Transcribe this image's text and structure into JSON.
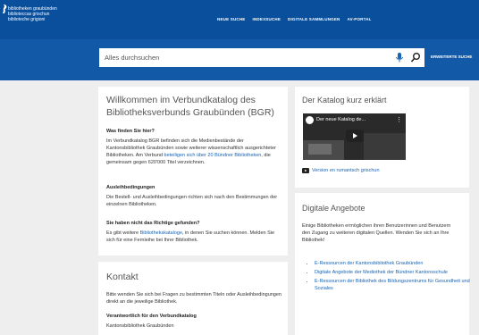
{
  "header": {
    "logo_lines": [
      "bibliotheken graubünden",
      "biblioteccas grischun",
      "biblioteche grigioni"
    ],
    "nav": [
      "NEUE SUCHE",
      "INDEXSUCHE",
      "DIGITALE SAMMLUNGEN",
      "AV-PORTAL"
    ]
  },
  "search": {
    "placeholder": "Alles durchsuchen",
    "advanced_label": "ERWEITERTE SUCHE",
    "mic_icon": "microphone-icon",
    "search_icon": "magnifier-icon"
  },
  "welcome": {
    "title": "Willkommen im Verbundkatalog des Bibliotheksverbunds Graubünden (BGR)",
    "s1_heading": "Was finden Sie hier?",
    "s1_text_a": "Im Verbundkatalog BGR befinden sich die Medienbestände der Kantonsbibliothek Graubünden sowie weiterer wissenschaftlich ausgerichteter Bibliotheken. Am Verbund ",
    "s1_link": "beteiligen sich über 20 Bündner Bibliotheken",
    "s1_text_b": ", die gemeinsam gegen 620'000 Titel verzeichnen.",
    "s2_heading": "Ausleihbedingungen",
    "s2_text": "Die Bestell- und Ausleihbedingungen richten sich nach den Bestimmungen der einzelnen Bibliotheken.",
    "s3_heading": "Sie haben nicht das Richtige gefunden?",
    "s3_text_a": "Es gibt weitere ",
    "s3_link": "Bibliothekskataloge",
    "s3_text_b": ", in denen Sie suchen können. Melden Sie sich für eine Fernleihe bei Ihrer Bibliothek."
  },
  "kontakt": {
    "title": "Kontakt",
    "text": "Bitte wenden Sie sich bei Fragen zu bestimmten Titeln oder Ausleihbedingungen direkt an die jeweilige Bibliothek.",
    "heading": "Verantwortlich für den Verbundkatalog",
    "cutoff": "Kantonsbibliothek Graubünden"
  },
  "katalog": {
    "title": "Der Katalog kurz erklärt",
    "video_title": "Der neue Katalog de...",
    "link": "Version en rumantsch grischun"
  },
  "digital": {
    "title": "Digitale Angebote",
    "text": "Einige Bibliotheken ermöglichen ihren Benutzerinnen und Benutzern den Zugang zu weiteren digitalen Quellen. Wenden Sie sich an Ihre Bibliothek!",
    "items": [
      "E-Ressourcen der Kantonsbibliothek Graubünden",
      "Digitale Angebote der Mediothek der Bündner Kantonsschule",
      "E-Ressourcen der Bibliothek des Bildungszentrums für Gesundheit und Soziales"
    ]
  }
}
